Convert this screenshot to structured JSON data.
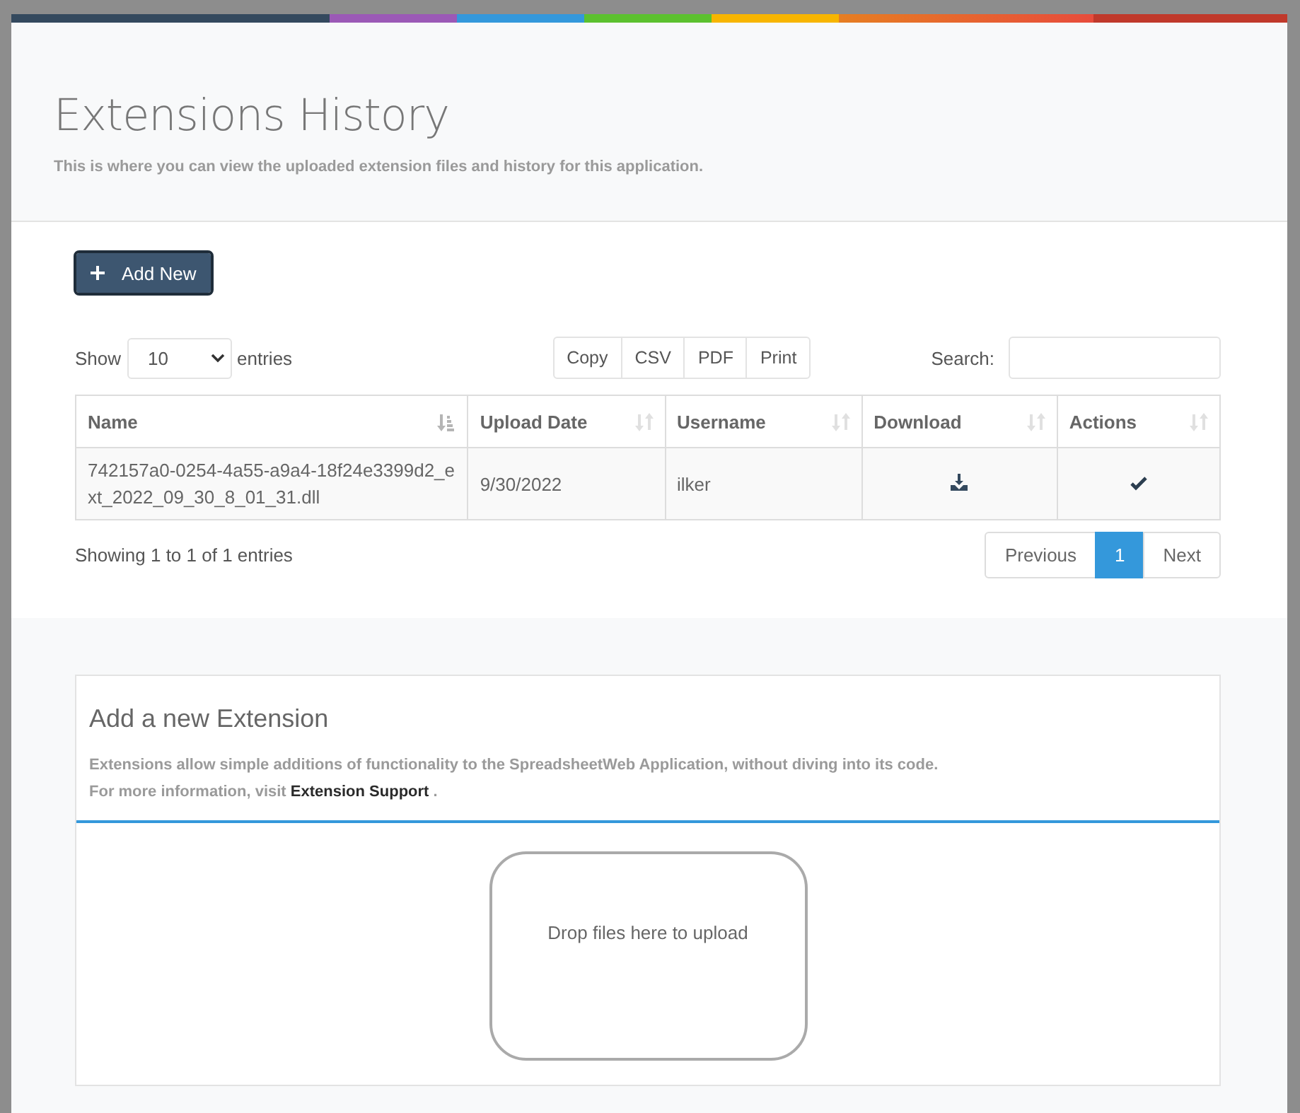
{
  "header": {
    "title": "Extensions History",
    "subtitle": "This is where you can view the uploaded extension files and history for this application."
  },
  "add_button": {
    "label": "Add New"
  },
  "length_control": {
    "prefix": "Show",
    "value": "10",
    "suffix": "entries"
  },
  "export_buttons": [
    "Copy",
    "CSV",
    "PDF",
    "Print"
  ],
  "search": {
    "label": "Search:"
  },
  "table": {
    "columns": [
      {
        "label": "Name",
        "sorted": true
      },
      {
        "label": "Upload Date",
        "sorted": false
      },
      {
        "label": "Username",
        "sorted": false
      },
      {
        "label": "Download",
        "sorted": false
      },
      {
        "label": "Actions",
        "sorted": false
      }
    ],
    "rows": [
      {
        "name": "742157a0-0254-4a55-a9a4-18f24e3399d2_ext_2022_09_30_8_01_31.dll",
        "upload_date": "9/30/2022",
        "username": "ilker"
      }
    ]
  },
  "info": "Showing 1 to 1 of 1 entries",
  "pagination": [
    {
      "label": "Previous",
      "selected": false
    },
    {
      "label": "1",
      "selected": true
    },
    {
      "label": "Next",
      "selected": false
    }
  ],
  "extension_card": {
    "title": "Add a new Extension",
    "description": "Extensions allow simple additions of functionality to the SpreadsheetWeb Application, without diving into its code.",
    "more_prefix": "For more information, visit",
    "link": "Extension Support",
    "more_suffix": ".",
    "dropzone": "Drop files here to upload"
  }
}
